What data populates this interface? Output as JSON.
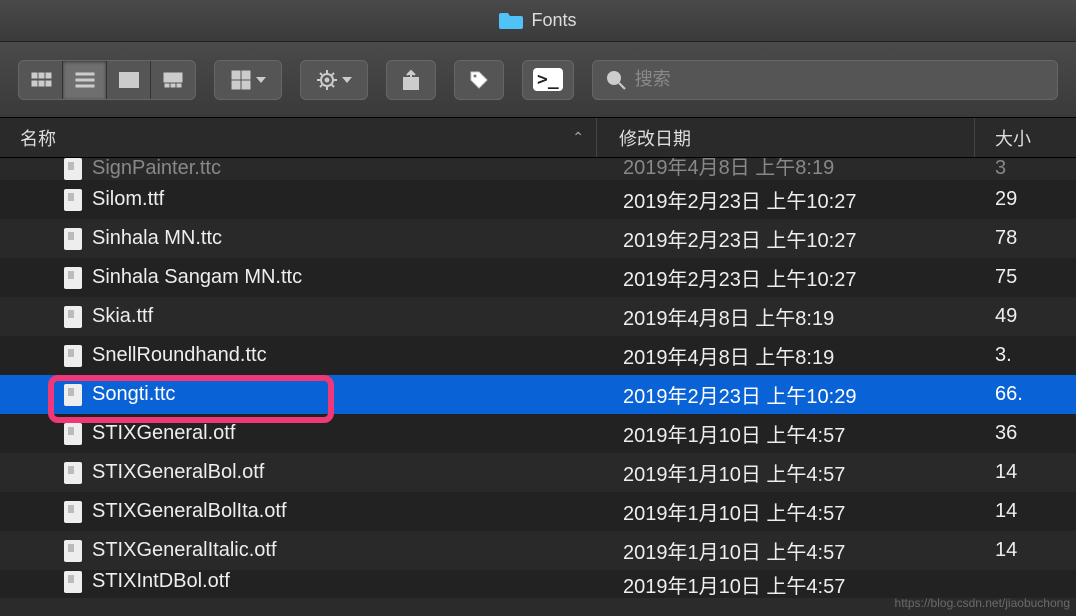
{
  "window": {
    "title": "Fonts"
  },
  "toolbar": {
    "search_placeholder": "搜索"
  },
  "columns": {
    "name": "名称",
    "date": "修改日期",
    "size": "大小"
  },
  "files": [
    {
      "name": "SignPainter.ttc",
      "date": "2019年4月8日 上午8:19",
      "size": "3"
    },
    {
      "name": "Silom.ttf",
      "date": "2019年2月23日 上午10:27",
      "size": "29"
    },
    {
      "name": "Sinhala MN.ttc",
      "date": "2019年2月23日 上午10:27",
      "size": "78"
    },
    {
      "name": "Sinhala Sangam MN.ttc",
      "date": "2019年2月23日 上午10:27",
      "size": "75"
    },
    {
      "name": "Skia.ttf",
      "date": "2019年4月8日 上午8:19",
      "size": "49"
    },
    {
      "name": "SnellRoundhand.ttc",
      "date": "2019年4月8日 上午8:19",
      "size": "3."
    },
    {
      "name": "Songti.ttc",
      "date": "2019年2月23日 上午10:29",
      "size": "66."
    },
    {
      "name": "STIXGeneral.otf",
      "date": "2019年1月10日 上午4:57",
      "size": "36"
    },
    {
      "name": "STIXGeneralBol.otf",
      "date": "2019年1月10日 上午4:57",
      "size": "14"
    },
    {
      "name": "STIXGeneralBolIta.otf",
      "date": "2019年1月10日 上午4:57",
      "size": "14"
    },
    {
      "name": "STIXGeneralItalic.otf",
      "date": "2019年1月10日 上午4:57",
      "size": "14"
    },
    {
      "name": "STIXIntDBol.otf",
      "date": "2019年1月10日 上午4:57",
      "size": ""
    }
  ],
  "selected_index": 6,
  "watermark": "https://blog.csdn.net/jiaobuchong"
}
